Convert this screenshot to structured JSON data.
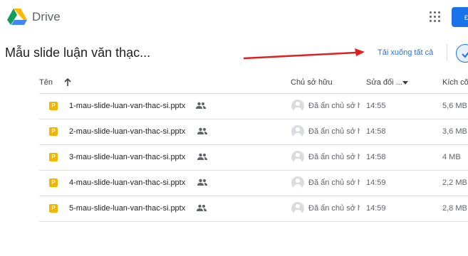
{
  "header": {
    "brand": "Drive",
    "signin_label": "Đ"
  },
  "folder": {
    "title": "Mẫu slide luận văn thạc...",
    "download_all": "Tải xuống tất cả"
  },
  "columns": {
    "name": "Tên",
    "owner": "Chủ sở hữu",
    "modified": "Sửa đổi ...",
    "size": "Kích cỡ"
  },
  "files": [
    {
      "icon": "P",
      "name": "1-mau-slide-luan-van-thac-si.pptx",
      "owner": "Đã ẩn chủ sở hữu",
      "modified": "14:55",
      "size": "5,6 MB"
    },
    {
      "icon": "P",
      "name": "2-mau-slide-luan-van-thac-si.pptx",
      "owner": "Đã ẩn chủ sở hữu",
      "modified": "14:58",
      "size": "3,6 MB"
    },
    {
      "icon": "P",
      "name": "3-mau-slide-luan-van-thac-si.pptx",
      "owner": "Đã ẩn chủ sở hữu",
      "modified": "14:58",
      "size": "4 MB"
    },
    {
      "icon": "P",
      "name": "4-mau-slide-luan-van-thac-si.pptx",
      "owner": "Đã ẩn chủ sở hữu",
      "modified": "14:59",
      "size": "2,2 MB"
    },
    {
      "icon": "P",
      "name": "5-mau-slide-luan-van-thac-si.pptx",
      "owner": "Đã ẩn chủ sở hữu",
      "modified": "14:59",
      "size": "2,8 MB"
    }
  ],
  "colors": {
    "accent": "#1a73e8",
    "slides_yellow": "#f4b400",
    "annotation_arrow": "#e02020"
  }
}
